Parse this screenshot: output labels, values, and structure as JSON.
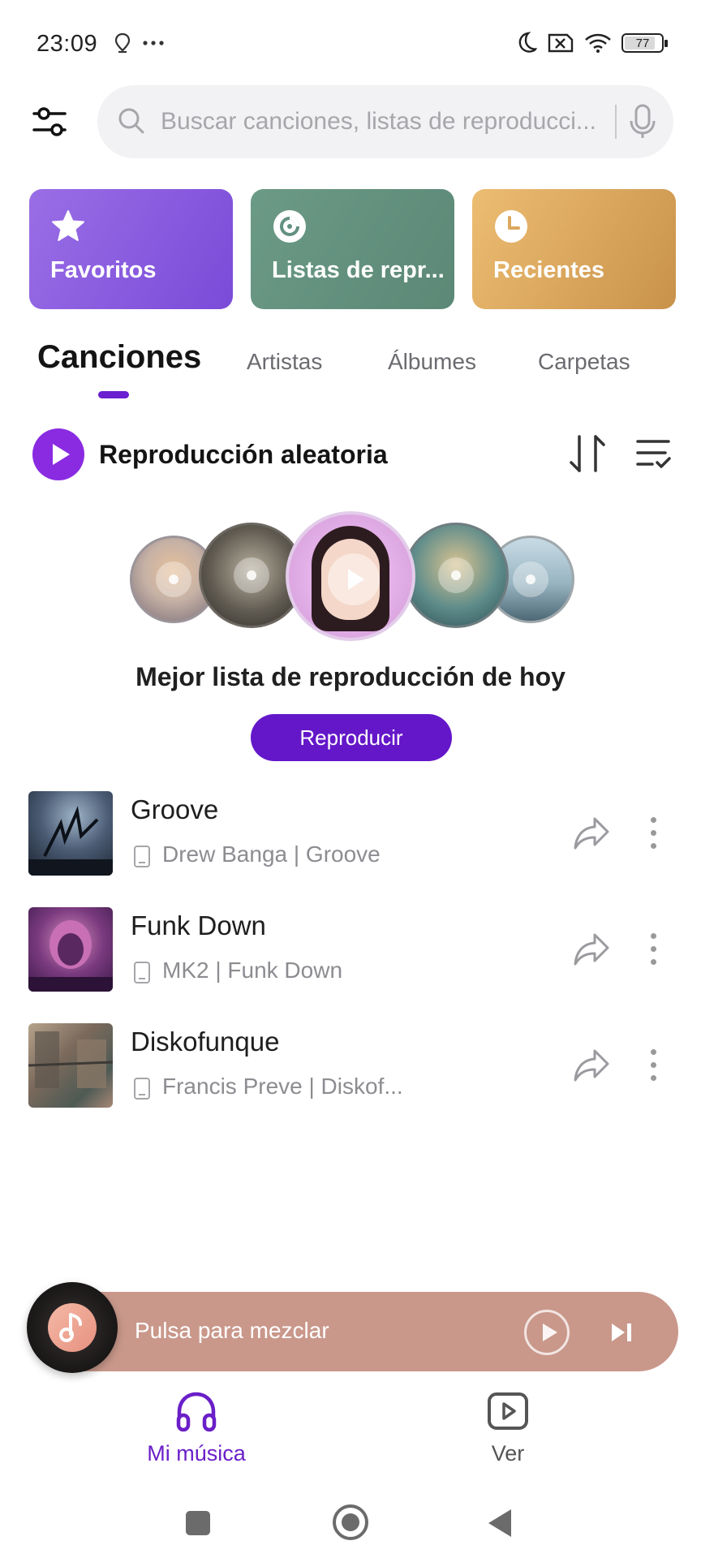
{
  "status_bar": {
    "time": "23:09",
    "battery": "77",
    "icons": [
      "location-icon",
      "more-dots-icon",
      "moon-icon",
      "no-sim-icon",
      "wifi-icon",
      "battery-icon"
    ]
  },
  "search": {
    "placeholder": "Buscar canciones, listas de reproducci..."
  },
  "categories": [
    {
      "label": "Favoritos",
      "icon": "star-icon",
      "color": "#8b5cdf"
    },
    {
      "label": "Listas de repr...",
      "icon": "disc-icon",
      "color": "#639180"
    },
    {
      "label": "Recientes",
      "icon": "clock-icon",
      "color": "#dba85e"
    }
  ],
  "tabs": [
    {
      "label": "Canciones",
      "active": true
    },
    {
      "label": "Artistas",
      "active": false
    },
    {
      "label": "Álbumes",
      "active": false
    },
    {
      "label": "Carpetas",
      "active": false
    }
  ],
  "shuffle": {
    "label": "Reproducción aleatoria"
  },
  "best_playlist": {
    "title": "Mejor lista de reproducción de hoy",
    "button": "Reproducir"
  },
  "songs": [
    {
      "title": "Groove",
      "subtitle": "Drew Banga | Groove"
    },
    {
      "title": "Funk Down",
      "subtitle": "MK2 | Funk Down"
    },
    {
      "title": "Diskofunque",
      "subtitle": "Francis Preve | Diskof..."
    }
  ],
  "mini_player": {
    "label": "Pulsa para mezclar",
    "color": "#c9988b"
  },
  "bottom_nav": [
    {
      "label": "Mi música",
      "icon": "headphones-icon",
      "active": true
    },
    {
      "label": "Ver",
      "icon": "video-play-icon",
      "active": false
    }
  ],
  "accent": "#6a1fd0"
}
